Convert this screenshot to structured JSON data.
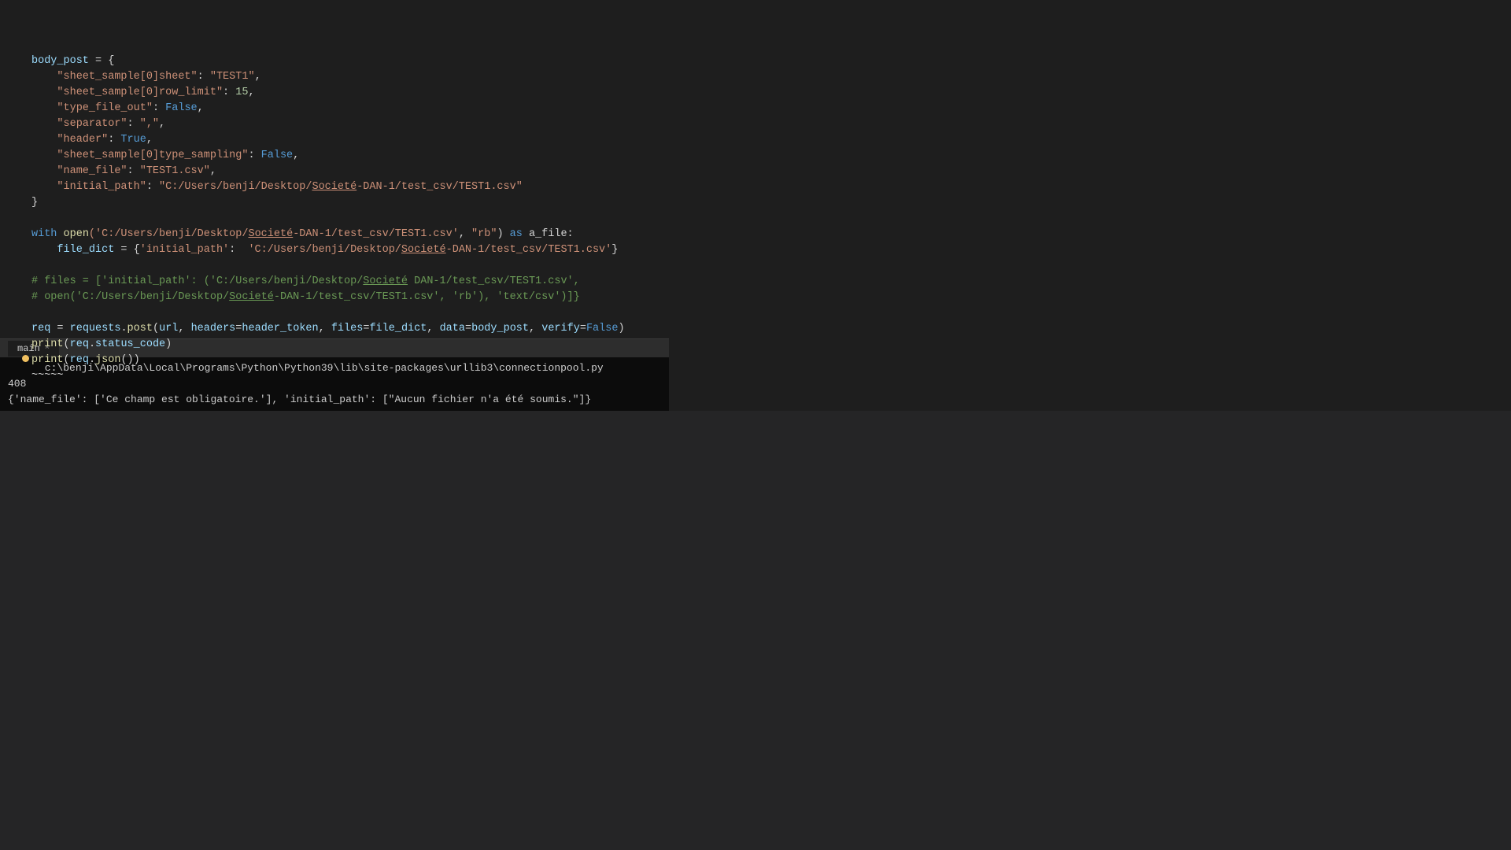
{
  "editor": {
    "background": "#1e1e1e",
    "lines": [
      {
        "id": 1,
        "gutter": "",
        "tokens": [
          {
            "text": "body_post",
            "class": "t-cyan"
          },
          {
            "text": " = {",
            "class": "t-white"
          }
        ]
      },
      {
        "id": 2,
        "gutter": "",
        "tokens": [
          {
            "text": "    ",
            "class": "t-white"
          },
          {
            "text": "\"sheet_sample[0]sheet\"",
            "class": "t-string"
          },
          {
            "text": ": ",
            "class": "t-white"
          },
          {
            "text": "\"TEST1\"",
            "class": "t-orange"
          },
          {
            "text": ",",
            "class": "t-white"
          }
        ]
      },
      {
        "id": 3,
        "gutter": "",
        "tokens": [
          {
            "text": "    ",
            "class": "t-white"
          },
          {
            "text": "\"sheet_sample[0]row_limit\"",
            "class": "t-string"
          },
          {
            "text": ": ",
            "class": "t-white"
          },
          {
            "text": "15",
            "class": "t-number"
          },
          {
            "text": ",",
            "class": "t-white"
          }
        ]
      },
      {
        "id": 4,
        "gutter": "",
        "tokens": [
          {
            "text": "    ",
            "class": "t-white"
          },
          {
            "text": "\"type_file_out\"",
            "class": "t-string"
          },
          {
            "text": ": ",
            "class": "t-white"
          },
          {
            "text": "False",
            "class": "t-bool"
          },
          {
            "text": ",",
            "class": "t-white"
          }
        ]
      },
      {
        "id": 5,
        "gutter": "",
        "tokens": [
          {
            "text": "    ",
            "class": "t-white"
          },
          {
            "text": "\"separator\"",
            "class": "t-string"
          },
          {
            "text": ": ",
            "class": "t-white"
          },
          {
            "text": "\",\"",
            "class": "t-orange"
          },
          {
            "text": ",",
            "class": "t-white"
          }
        ]
      },
      {
        "id": 6,
        "gutter": "",
        "tokens": [
          {
            "text": "    ",
            "class": "t-white"
          },
          {
            "text": "\"header\"",
            "class": "t-string"
          },
          {
            "text": ": ",
            "class": "t-white"
          },
          {
            "text": "True",
            "class": "t-bool"
          },
          {
            "text": ",",
            "class": "t-white"
          }
        ]
      },
      {
        "id": 7,
        "gutter": "",
        "tokens": [
          {
            "text": "    ",
            "class": "t-white"
          },
          {
            "text": "\"sheet_sample[0]type_sampling\"",
            "class": "t-string"
          },
          {
            "text": ": ",
            "class": "t-white"
          },
          {
            "text": "False",
            "class": "t-bool"
          },
          {
            "text": ",",
            "class": "t-white"
          }
        ]
      },
      {
        "id": 8,
        "gutter": "",
        "tokens": [
          {
            "text": "    ",
            "class": "t-white"
          },
          {
            "text": "\"name_file\"",
            "class": "t-string"
          },
          {
            "text": ": ",
            "class": "t-white"
          },
          {
            "text": "\"TEST1.csv\"",
            "class": "t-orange"
          },
          {
            "text": ",",
            "class": "t-white"
          }
        ]
      },
      {
        "id": 9,
        "gutter": "",
        "tokens": [
          {
            "text": "    ",
            "class": "t-white"
          },
          {
            "text": "\"initial_path\"",
            "class": "t-string"
          },
          {
            "text": ": ",
            "class": "t-white"
          },
          {
            "text": "\"C:/Users/benji/Desktop/",
            "class": "t-orange"
          },
          {
            "text": "Societé",
            "class": "t-orange t-underline"
          },
          {
            "text": "-DAN-1/test_csv/TEST1.csv\"",
            "class": "t-orange"
          }
        ]
      },
      {
        "id": 10,
        "gutter": "",
        "tokens": [
          {
            "text": "}",
            "class": "t-white"
          }
        ]
      },
      {
        "id": 11,
        "gutter": "",
        "tokens": []
      },
      {
        "id": 12,
        "gutter": "",
        "tokens": [
          {
            "text": "with",
            "class": "t-kw2"
          },
          {
            "text": " ",
            "class": "t-white"
          },
          {
            "text": "open",
            "class": "t-yellow"
          },
          {
            "text": "('C:/Users/benji/Desktop/",
            "class": "t-orange"
          },
          {
            "text": "Societé",
            "class": "t-orange t-underline"
          },
          {
            "text": "-DAN-1/test_csv/TEST1.csv'",
            "class": "t-orange"
          },
          {
            "text": ", ",
            "class": "t-white"
          },
          {
            "text": "\"rb\"",
            "class": "t-orange"
          },
          {
            "text": ") ",
            "class": "t-white"
          },
          {
            "text": "as",
            "class": "t-kw2"
          },
          {
            "text": " a_file:",
            "class": "t-white"
          }
        ]
      },
      {
        "id": 13,
        "gutter": "",
        "tokens": [
          {
            "text": "    ",
            "class": "t-white"
          },
          {
            "text": "file_dict",
            "class": "t-cyan"
          },
          {
            "text": " = {",
            "class": "t-white"
          },
          {
            "text": "'initial_path'",
            "class": "t-orange"
          },
          {
            "text": ": ",
            "class": "t-white"
          },
          {
            "text": " 'C:/Users/benji/Desktop/",
            "class": "t-orange"
          },
          {
            "text": "Societé",
            "class": "t-orange t-underline"
          },
          {
            "text": "-DAN-1/test_csv/TEST1.csv'",
            "class": "t-orange"
          },
          {
            "text": "}",
            "class": "t-white"
          }
        ]
      },
      {
        "id": 14,
        "gutter": "",
        "tokens": []
      },
      {
        "id": 15,
        "gutter": "",
        "tokens": [
          {
            "text": "# files = [",
            "class": "t-comment"
          },
          {
            "text": "'initial_path'",
            "class": "t-comment"
          },
          {
            "text": ": (",
            "class": "t-comment"
          },
          {
            "text": "'C:/Users/benji/Desktop/",
            "class": "t-comment"
          },
          {
            "text": "Societé",
            "class": "t-comment t-underline"
          },
          {
            "text": " DAN-1/test_csv/TEST1.csv'",
            "class": "t-comment"
          },
          {
            "text": ",",
            "class": "t-comment"
          }
        ]
      },
      {
        "id": 16,
        "gutter": "",
        "tokens": [
          {
            "text": "# open('C:/Users/benji/Desktop/",
            "class": "t-comment"
          },
          {
            "text": "Societé",
            "class": "t-comment t-underline"
          },
          {
            "text": "-DAN-1/test_csv/TEST1.csv', 'rb'), 'text/csv')]}",
            "class": "t-comment"
          }
        ]
      },
      {
        "id": 17,
        "gutter": "",
        "tokens": []
      },
      {
        "id": 18,
        "gutter": "",
        "tokens": [
          {
            "text": "req",
            "class": "t-cyan"
          },
          {
            "text": " = ",
            "class": "t-white"
          },
          {
            "text": "requests",
            "class": "t-cyan"
          },
          {
            "text": ".",
            "class": "t-white"
          },
          {
            "text": "post",
            "class": "t-yellow"
          },
          {
            "text": "(",
            "class": "t-white"
          },
          {
            "text": "url",
            "class": "t-cyan"
          },
          {
            "text": ", ",
            "class": "t-white"
          },
          {
            "text": "headers",
            "class": "t-param"
          },
          {
            "text": "=",
            "class": "t-white"
          },
          {
            "text": "header_token",
            "class": "t-cyan"
          },
          {
            "text": ", ",
            "class": "t-white"
          },
          {
            "text": "files",
            "class": "t-param"
          },
          {
            "text": "=",
            "class": "t-white"
          },
          {
            "text": "file_dict",
            "class": "t-cyan"
          },
          {
            "text": ", ",
            "class": "t-white"
          },
          {
            "text": "data",
            "class": "t-param"
          },
          {
            "text": "=",
            "class": "t-white"
          },
          {
            "text": "body_post",
            "class": "t-cyan"
          },
          {
            "text": ", ",
            "class": "t-white"
          },
          {
            "text": "verify",
            "class": "t-param"
          },
          {
            "text": "=",
            "class": "t-white"
          },
          {
            "text": "False",
            "class": "t-bool"
          },
          {
            "text": ")",
            "class": "t-white"
          }
        ]
      },
      {
        "id": 19,
        "gutter": "",
        "tokens": [
          {
            "text": "print",
            "class": "t-yellow"
          },
          {
            "text": "(",
            "class": "t-white"
          },
          {
            "text": "req",
            "class": "t-cyan"
          },
          {
            "text": ".",
            "class": "t-white"
          },
          {
            "text": "status_code",
            "class": "t-cyan"
          },
          {
            "text": ")",
            "class": "t-white"
          }
        ]
      },
      {
        "id": 20,
        "gutter": "dot",
        "tokens": [
          {
            "text": "print",
            "class": "t-yellow"
          },
          {
            "text": "(",
            "class": "t-white"
          },
          {
            "text": "req",
            "class": "t-cyan"
          },
          {
            "text": ".",
            "class": "t-white"
          },
          {
            "text": "json",
            "class": "t-yellow"
          },
          {
            "text": "())",
            "class": "t-white"
          }
        ]
      },
      {
        "id": 21,
        "gutter": "",
        "tokens": [
          {
            "text": "~~~~~",
            "class": "t-white"
          }
        ]
      }
    ]
  },
  "terminal": {
    "tab_label": "main",
    "tab_close": "×",
    "lines": [
      {
        "text": "      c:\\benji\\AppData\\Local\\Programs\\Python\\Python39\\lib\\site-packages\\urllib3\\connectionpool.py",
        "class": "terminal-line"
      },
      {
        "text": "408",
        "class": "terminal-line"
      },
      {
        "text": "{'name_file': ['Ce champ est obligatoire.'], 'initial_path': [\"Aucun fichier n'a été soumis.\"]}",
        "class": "terminal-line"
      }
    ]
  }
}
